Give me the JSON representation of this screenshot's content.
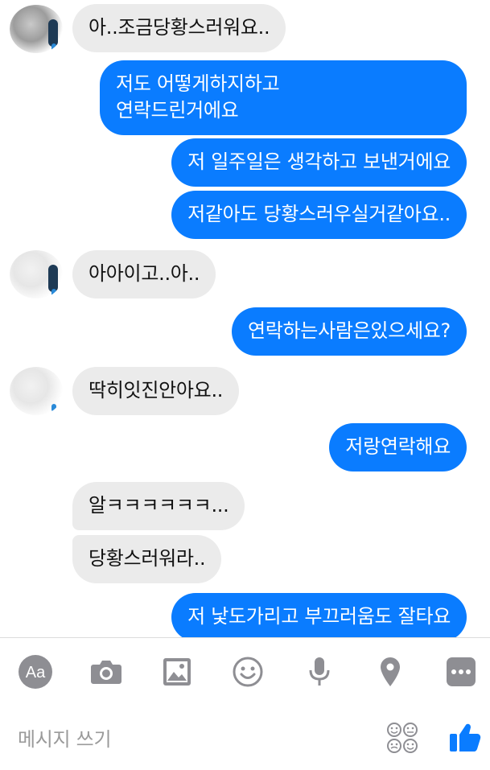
{
  "conversation": {
    "messages": [
      {
        "side": "in",
        "text": "아..조금당황스러워요.."
      },
      {
        "side": "out",
        "text": "저도 어떻게하지하고\n연락드린거에요"
      },
      {
        "side": "out",
        "text": "저 일주일은 생각하고 보낸거에요"
      },
      {
        "side": "out",
        "text": "저같아도 당황스러우실거같아요.."
      },
      {
        "side": "in",
        "text": "아아이고..아.."
      },
      {
        "side": "out",
        "text": "연락하는사람은있으세요?"
      },
      {
        "side": "in",
        "text": "딱히잇진안아요.."
      },
      {
        "side": "out",
        "text": "저랑연락해요"
      },
      {
        "side": "in",
        "text": "알ㅋㅋㅋㅋㅋㅋ..."
      },
      {
        "side": "in",
        "text": "당황스러워라.."
      },
      {
        "side": "out",
        "text": "저 낯도가리고 부끄러움도 잘타요"
      }
    ]
  },
  "toolbar": {
    "text_icon_label": "Aa",
    "icons": [
      "text-format-icon",
      "camera-icon",
      "gallery-icon",
      "emoji-icon",
      "microphone-icon",
      "location-icon",
      "more-icon"
    ]
  },
  "composer": {
    "placeholder": "메시지 쓰기",
    "sticker_icon": "sticker-icon",
    "like_icon": "thumbs-up-icon"
  },
  "colors": {
    "outgoing_bubble": "#0a7cff",
    "incoming_bubble": "#ebebeb",
    "icon_gray": "#8e8e93",
    "accent": "#0a7cff"
  }
}
